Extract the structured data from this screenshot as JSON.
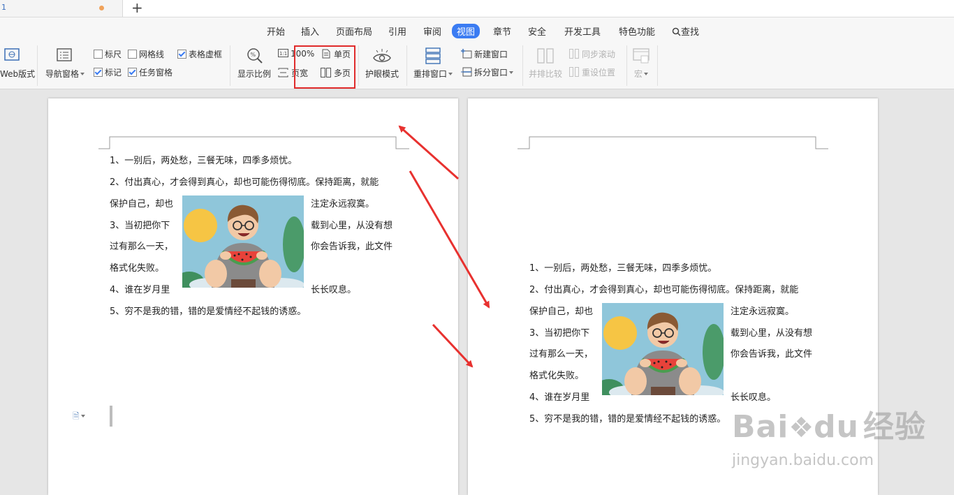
{
  "tab": {
    "label": "1"
  },
  "menu": [
    "开始",
    "插入",
    "页面布局",
    "引用",
    "审阅",
    "视图",
    "章节",
    "安全",
    "开发工具",
    "特色功能",
    "查找"
  ],
  "toolbar": {
    "web_layout": "Web版式",
    "nav_pane": "导航窗格",
    "ruler": "标尺",
    "gridlines": "网格线",
    "table_gridlines": "表格虚框",
    "markup": "标记",
    "task_pane": "任务窗格",
    "zoom_ratio": "显示比例",
    "zoom_100": "100%",
    "one_page": "单页",
    "page_width": "页宽",
    "multi_page": "多页",
    "eye_mode": "护眼模式",
    "rearrange": "重排窗口",
    "new_window": "新建窗口",
    "split_window": "拆分窗口",
    "side_by_side": "并排比较",
    "sync_scroll": "同步滚动",
    "reset_position": "重设位置",
    "macro": "宏"
  },
  "checkboxes": {
    "ruler": false,
    "gridlines": false,
    "table_gridlines": true,
    "markup": true,
    "task_pane": true
  },
  "document": {
    "lines": [
      "1、一别后，两处愁，三餐无味，四季多烦忧。",
      "2、付出真心，才会得到真心，却也可能伤得彻底。保持距离，就能",
      "保护自己，却也",
      "注定永远寂寞。",
      "3、当初把你下",
      "载到心里，从没有想",
      "过有那么一天，",
      "你会告诉我，此文件",
      "格式化失败。",
      "4、谁在岁月里",
      "长长叹息。",
      "5、穷不是我的错，错的是爱情经不起钱的诱惑。"
    ]
  },
  "watermark": {
    "brand": "Bai",
    "brand2": "du",
    "cn": "经验",
    "url": "jingyan.baidu.com"
  },
  "colors": {
    "accent": "#3b7cf2",
    "highlight": "#e02b2b"
  }
}
